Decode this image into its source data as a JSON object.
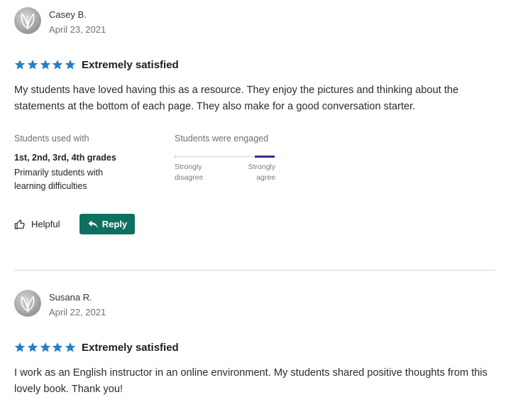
{
  "colors": {
    "star": "#2a7ec2",
    "reply_button": "#0e7060",
    "engagement_bar": "#2f2f8c",
    "divider": "#d8d8d8"
  },
  "icons": {
    "avatar": "leaf-avatar-icon",
    "star": "star-icon",
    "helpful": "thumbs-up-icon",
    "reply": "reply-arrow-icon"
  },
  "reviews": [
    {
      "name": "Casey B.",
      "date": "April 23, 2021",
      "stars": 5,
      "rating_label": "Extremely satisfied",
      "text": "My students have loved having this as a resource. They enjoy the pictures and thinking about the statements at the bottom of each page. They also make for a good conversation starter.",
      "students_used_with_title": "Students used with",
      "grades": "1st, 2nd, 3rd, 4th grades",
      "students_note": "Primarily students with learning difficulties",
      "engagement": {
        "title": "Students were engaged",
        "low_label_1": "Strongly",
        "low_label_2": "disagree",
        "high_label_1": "Strongly",
        "high_label_2": "agree",
        "level_fraction": 1.0
      },
      "helpful_label": "Helpful",
      "reply_label": "Reply"
    },
    {
      "name": "Susana R.",
      "date": "April 22, 2021",
      "stars": 5,
      "rating_label": "Extremely satisfied",
      "text": "I work as an English instructor in an online environment. My students shared positive thoughts from this lovely book. Thank you!"
    }
  ]
}
